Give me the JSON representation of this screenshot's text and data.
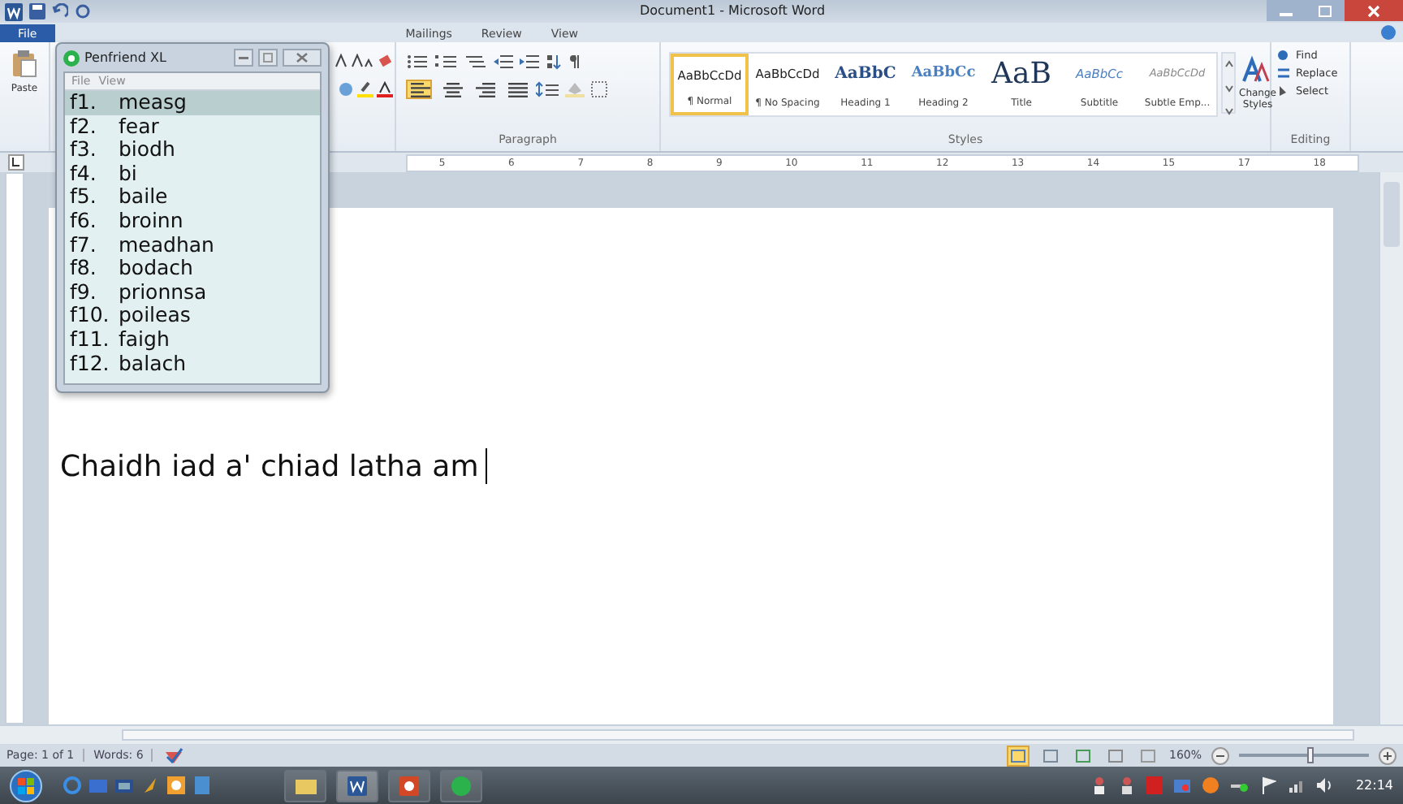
{
  "window": {
    "title": "Document1 - Microsoft Word"
  },
  "tabs": [
    {
      "label": "File",
      "kind": "file"
    },
    {
      "label": "Mailings",
      "kind": "tab"
    },
    {
      "label": "Review",
      "kind": "tab"
    },
    {
      "label": "View",
      "kind": "tab"
    }
  ],
  "ribbon": {
    "paste_label": "Paste",
    "paragraph_label": "Paragraph",
    "alignment_buttons": [
      {
        "kind": "left",
        "selected": true
      },
      {
        "kind": "center",
        "selected": false
      },
      {
        "kind": "right",
        "selected": false
      },
      {
        "kind": "justify",
        "selected": false
      }
    ],
    "styles_label": "Styles",
    "styles": [
      {
        "preview": "AaBbCcDd",
        "label": "¶ Normal",
        "kind": "normal",
        "selected": true
      },
      {
        "preview": "AaBbCcDd",
        "label": "¶ No Spacing",
        "kind": "normal",
        "selected": false
      },
      {
        "preview": "AaBbC",
        "label": "Heading 1",
        "kind": "heading1",
        "selected": false
      },
      {
        "preview": "AaBbCc",
        "label": "Heading 2",
        "kind": "heading2",
        "selected": false
      },
      {
        "preview": "AaB",
        "label": "Title",
        "kind": "title",
        "selected": false
      },
      {
        "preview": "AaBbCc",
        "label": "Subtitle",
        "kind": "subtitle",
        "selected": false
      },
      {
        "preview": "AaBbCcDd",
        "label": "Subtle Emp...",
        "kind": "subtle",
        "selected": false
      }
    ],
    "change_styles": "Change Styles",
    "editing_label": "Editing",
    "editing": [
      "Find",
      "Replace",
      "Select"
    ]
  },
  "ruler": [
    "5",
    "6",
    "7",
    "8",
    "9",
    "10",
    "11",
    "12",
    "13",
    "14",
    "15",
    "17",
    "18"
  ],
  "document": {
    "text": "Chaidh iad a' chiad latha am"
  },
  "status_bar": {
    "page": "Page: 1 of 1",
    "words": "Words: 6",
    "zoom": "160%",
    "zoom_slider": {
      "level": 0.55
    },
    "view_buttons": [
      {
        "kind": "print",
        "selected": true
      },
      {
        "kind": "read",
        "selected": false
      },
      {
        "kind": "web",
        "selected": false
      },
      {
        "kind": "outline",
        "selected": false
      },
      {
        "kind": "draft",
        "selected": false
      }
    ]
  },
  "penfriend": {
    "title": "Penfriend XL",
    "menu": [
      "File",
      "View"
    ],
    "items": [
      {
        "key": "f1.",
        "word": "measg",
        "selected": true
      },
      {
        "key": "f2.",
        "word": "fear",
        "selected": false
      },
      {
        "key": "f3.",
        "word": "biodh",
        "selected": false
      },
      {
        "key": "f4.",
        "word": "bi",
        "selected": false
      },
      {
        "key": "f5.",
        "word": "baile",
        "selected": false
      },
      {
        "key": "f6.",
        "word": "broinn",
        "selected": false
      },
      {
        "key": "f7.",
        "word": "meadhan",
        "selected": false
      },
      {
        "key": "f8.",
        "word": "bodach",
        "selected": false
      },
      {
        "key": "f9.",
        "word": "prionnsa",
        "selected": false
      },
      {
        "key": "f10.",
        "word": "poileas",
        "selected": false
      },
      {
        "key": "f11.",
        "word": "faigh",
        "selected": false
      },
      {
        "key": "f12.",
        "word": "balach",
        "selected": false
      }
    ]
  },
  "taskbar": {
    "clock": "22:14"
  }
}
